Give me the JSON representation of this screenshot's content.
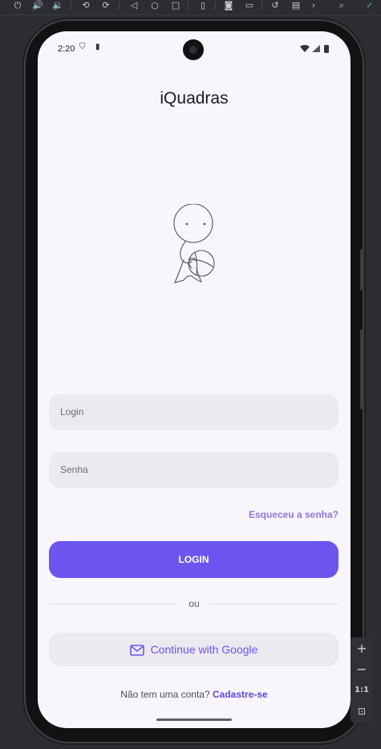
{
  "status_bar": {
    "time": "2:20"
  },
  "app": {
    "title": "iQuadras"
  },
  "form": {
    "login_placeholder": "Login",
    "password_placeholder": "Senha",
    "forgot_link": "Esqueceu a senha?",
    "login_button": "LOGIN",
    "divider_text": "ou",
    "google_button": "Continue with Google",
    "signup_prompt": "Não tem uma conta?",
    "signup_link": "Cadastre-se"
  },
  "emulator": {
    "zoom_label": "1:1"
  },
  "colors": {
    "accent": "#6b55ee",
    "background": "#f8f6fc",
    "field": "#ece9f0"
  }
}
